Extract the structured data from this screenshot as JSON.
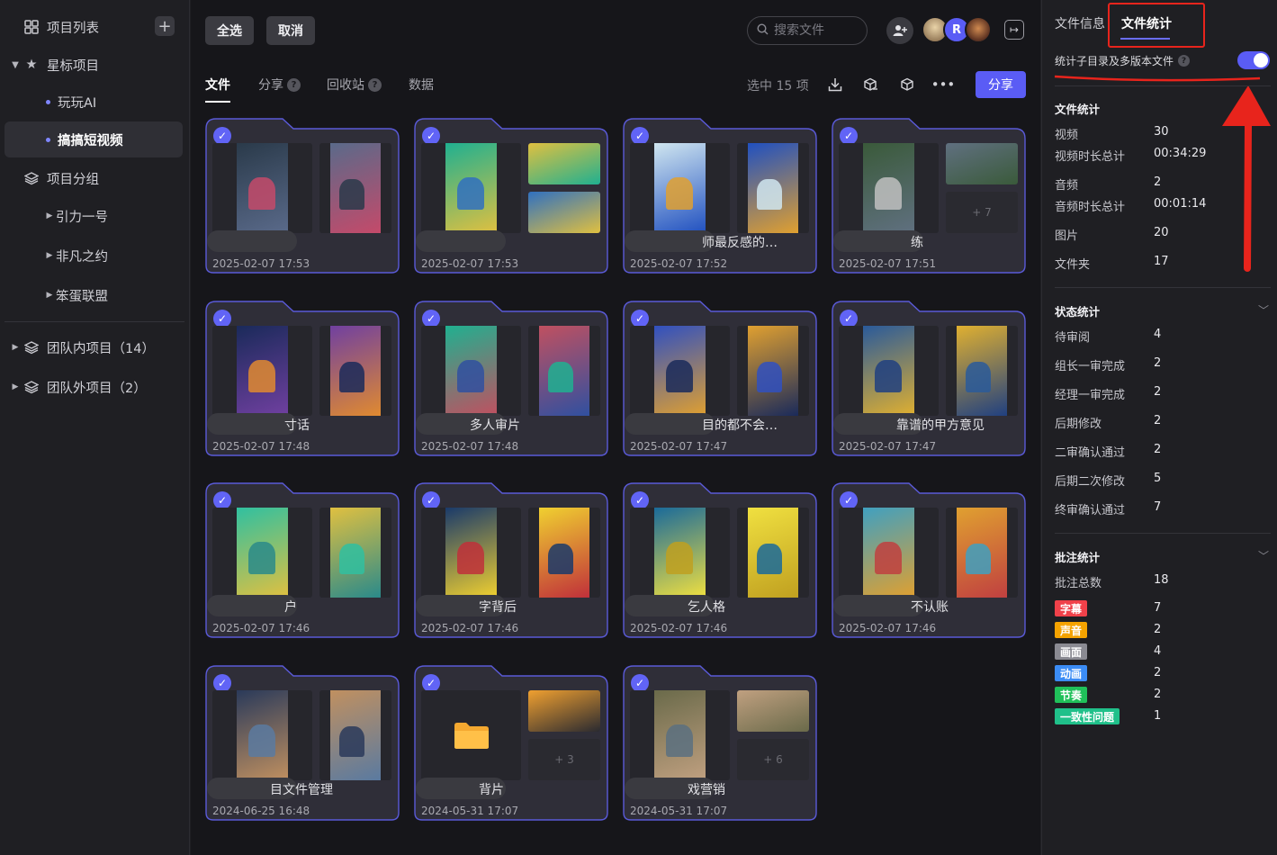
{
  "sidebar": {
    "project_list": "项目列表",
    "starred": "星标项目",
    "starred_items": [
      "玩玩AI",
      "搞搞短视频"
    ],
    "groups": "项目分组",
    "group_items": [
      "引力一号",
      "非凡之约",
      "笨蛋联盟"
    ],
    "team_in": "团队内项目（14）",
    "team_out": "团队外项目（2）"
  },
  "toolbar": {
    "select_all": "全选",
    "cancel": "取消",
    "search_placeholder": "搜索文件",
    "avatar_letter": "R"
  },
  "tabs": [
    {
      "label": "文件",
      "active": true
    },
    {
      "label": "分享",
      "help": "?"
    },
    {
      "label": "回收站",
      "help": "?"
    },
    {
      "label": "数据"
    }
  ],
  "selection": {
    "count_text": "选中 15 项",
    "share_label": "分享"
  },
  "cards": [
    {
      "name": "",
      "date": "2025-02-07 17:53"
    },
    {
      "name": "",
      "date": "2025-02-07 17:53"
    },
    {
      "name": "师最反感的…",
      "date": "2025-02-07 17:52"
    },
    {
      "name": "练",
      "date": "2025-02-07 17:51",
      "more": "+ 7"
    },
    {
      "name": "寸话",
      "date": "2025-02-07 17:48"
    },
    {
      "name": "多人审片",
      "date": "2025-02-07 17:48"
    },
    {
      "name": "目的都不会…",
      "date": "2025-02-07 17:47"
    },
    {
      "name": "靠谱的甲方意见",
      "date": "2025-02-07 17:47"
    },
    {
      "name": "户",
      "date": "2025-02-07 17:46"
    },
    {
      "name": "字背后",
      "date": "2025-02-07 17:46"
    },
    {
      "name": "乞人格",
      "date": "2025-02-07 17:46"
    },
    {
      "name": "不认账",
      "date": "2025-02-07 17:46"
    },
    {
      "name": "目文件管理",
      "date": "2024-06-25 16:48"
    },
    {
      "name": "背片",
      "date": "2024-05-31 17:07",
      "more": "+ 3"
    },
    {
      "name": "戏营销",
      "date": "2024-05-31 17:07",
      "more": "+ 6"
    }
  ],
  "right": {
    "tab_info": "文件信息",
    "tab_stats": "文件统计",
    "toggle_label": "统计子目录及多版本文件",
    "toggle_on": true,
    "file_stats_title": "文件统计",
    "file_stats": [
      {
        "label": "视频",
        "value": "30"
      },
      {
        "label": "视频时长总计",
        "value": "00:34:29"
      },
      {
        "label": "音频",
        "value": "2"
      },
      {
        "label": "音频时长总计",
        "value": "00:01:14"
      },
      {
        "label": "图片",
        "value": "20"
      },
      {
        "label": "文件夹",
        "value": "17"
      }
    ],
    "status_title": "状态统计",
    "status_stats": [
      {
        "label": "待审阅",
        "value": "4"
      },
      {
        "label": "组长一审完成",
        "value": "2"
      },
      {
        "label": "经理一审完成",
        "value": "2"
      },
      {
        "label": "后期修改",
        "value": "2"
      },
      {
        "label": "二审确认通过",
        "value": "2"
      },
      {
        "label": "后期二次修改",
        "value": "5"
      },
      {
        "label": "终审确认通过",
        "value": "7"
      }
    ],
    "note_title": "批注统计",
    "note_total_label": "批注总数",
    "note_total_value": "18",
    "tags": [
      {
        "label": "字幕",
        "value": "7",
        "color": "#f0414a"
      },
      {
        "label": "声音",
        "value": "2",
        "color": "#f5a300"
      },
      {
        "label": "画面",
        "value": "4",
        "color": "#8a8a92"
      },
      {
        "label": "动画",
        "value": "2",
        "color": "#3b8cf5"
      },
      {
        "label": "节奏",
        "value": "2",
        "color": "#20c05a"
      },
      {
        "label": "一致性问题",
        "value": "1",
        "color": "#20c08a"
      }
    ]
  }
}
